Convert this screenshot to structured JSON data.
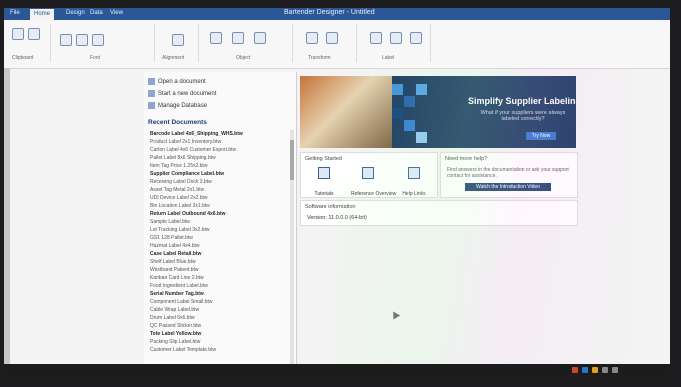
{
  "window": {
    "title": "Bartender Designer - Untitled",
    "tabs": [
      "File",
      "Home",
      "Design",
      "Data",
      "View"
    ],
    "active_tab": 1
  },
  "ribbon": {
    "groups": [
      "Clipboard",
      "Font",
      "Alignment",
      "Object",
      "Transform",
      "Label"
    ]
  },
  "pane": {
    "actions": [
      "Open a document",
      "Start a new document",
      "Manage Database"
    ],
    "recent_header": "Recent Documents",
    "recent_items": [
      "Barcode Label 4x6_Shipping_WHS.btw",
      "Product Label 2x1 Inventory.btw",
      "Carton Label 4x6 Customer Export.btw",
      "Pallet Label 8x6 Shipping.btw",
      "Item Tag Price 1.25x2.btw",
      "Supplier Compliance Label.btw",
      "Receiving Label Dock 3.btw",
      "Asset Tag Metal 2x1.btw",
      "UDI Device Label 2x2.btw",
      "Bin Location Label 3x1.btw",
      "Return Label Outbound 4x6.btw",
      "Sample Label.btw",
      "Lot Tracking Label 3x2.btw",
      "GS1 128 Pallet.btw",
      "Hazmat Label 4x4.btw",
      "Case Label Retail.btw",
      "Shelf Label Blue.btw",
      "Wristband Patient.btw",
      "Kanban Card Line 2.btw",
      "Food Ingredient Label.btw",
      "Serial Number Tag.btw",
      "Component Label Small.btw",
      "Cable Wrap Label.btw",
      "Drum Label 6x6.btw",
      "QC Passed Sticker.btw",
      "Tote Label Yellow.btw",
      "Packing Slip Label.btw",
      "Customer Label Template.btw"
    ]
  },
  "banner": {
    "title": "Simplify Supplier Labeling",
    "subtitle": "What if your suppliers were always labeled correctly?",
    "button": "Try Now"
  },
  "quick_actions": {
    "title": "Getting Started",
    "items": [
      "Tutorials",
      "Reference Overview",
      "Help Links"
    ]
  },
  "help": {
    "title": "Need more help?",
    "text": "Find answers in the documentation or ask your support contact for assistance.",
    "button": "Watch the Introduction Video"
  },
  "version": {
    "title": "Software information",
    "text": "Version: 11.0.0.0 (64-bit)"
  },
  "colors": {
    "accent": "#2b5797",
    "banner_bg": "#16365e",
    "button": "#2d74c8"
  }
}
